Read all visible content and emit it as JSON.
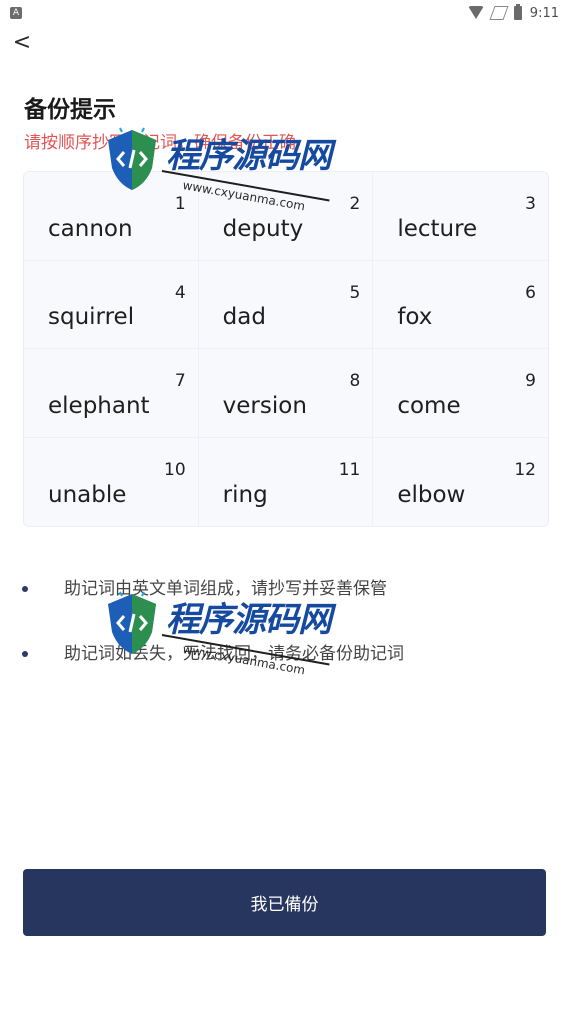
{
  "status_bar": {
    "time": "9:11",
    "icons": [
      "app-icon",
      "wifi-icon",
      "signal-icon",
      "battery-icon"
    ]
  },
  "header": {
    "back_label": "<",
    "title": "备份提示",
    "subtitle": "请按顺序抄写助记词，确保备份正确"
  },
  "grid": {
    "words": [
      {
        "index": "1",
        "word": "cannon"
      },
      {
        "index": "2",
        "word": "deputy"
      },
      {
        "index": "3",
        "word": "lecture"
      },
      {
        "index": "4",
        "word": "squirrel"
      },
      {
        "index": "5",
        "word": "dad"
      },
      {
        "index": "6",
        "word": "fox"
      },
      {
        "index": "7",
        "word": "elephant"
      },
      {
        "index": "8",
        "word": "version"
      },
      {
        "index": "9",
        "word": "come"
      },
      {
        "index": "10",
        "word": "unable"
      },
      {
        "index": "11",
        "word": "ring"
      },
      {
        "index": "12",
        "word": "elbow"
      }
    ]
  },
  "tips": {
    "items": [
      "助记词由英文单词组成，请抄写并妥善保管",
      "助记词如丢失，无法找回，请务必备份助记词"
    ]
  },
  "actions": {
    "confirm_label": "我已備份"
  },
  "watermark": {
    "text": "程序源码网",
    "url": "www.cxyuanma.com"
  },
  "colors": {
    "accent": "#27365e",
    "subtitle": "#e05656",
    "watermark_blue": "#164aa0"
  }
}
